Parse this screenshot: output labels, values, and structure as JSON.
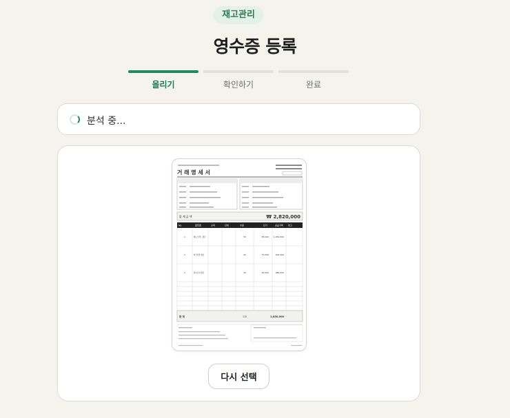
{
  "header": {
    "badge": "재고관리",
    "title": "영수증 등록"
  },
  "steps": [
    {
      "label": "올리기",
      "active": true
    },
    {
      "label": "확인하기",
      "active": false
    },
    {
      "label": "완료",
      "active": false
    }
  ],
  "status": {
    "text": "분석 중..."
  },
  "receipt_preview": {
    "title": "거 래 명 세 서",
    "total_label": "합 계 금 액",
    "total_amount": "₩ 2,820,000",
    "table_headers": [
      "No",
      "품목명",
      "규격",
      "단위",
      "수량",
      "단가",
      "공급가액",
      "비고"
    ],
    "rows": [
      {
        "no": "1",
        "item": "예도브랜드 원단",
        "qty": "50",
        "price": "58,000",
        "amount": "1,450,000"
      },
      {
        "no": "2",
        "item": "실크혼방 원단",
        "qty": "20",
        "price": "75,000",
        "amount": "500,000"
      },
      {
        "no": "3",
        "item": "울니트쳐 원단",
        "qty": "30",
        "price": "35,000",
        "amount": "980,000"
      }
    ],
    "sum_label": "합 계",
    "sum_qty": "110",
    "sum_amount": "2,830,000"
  },
  "actions": {
    "retry_label": "다시 선택"
  }
}
